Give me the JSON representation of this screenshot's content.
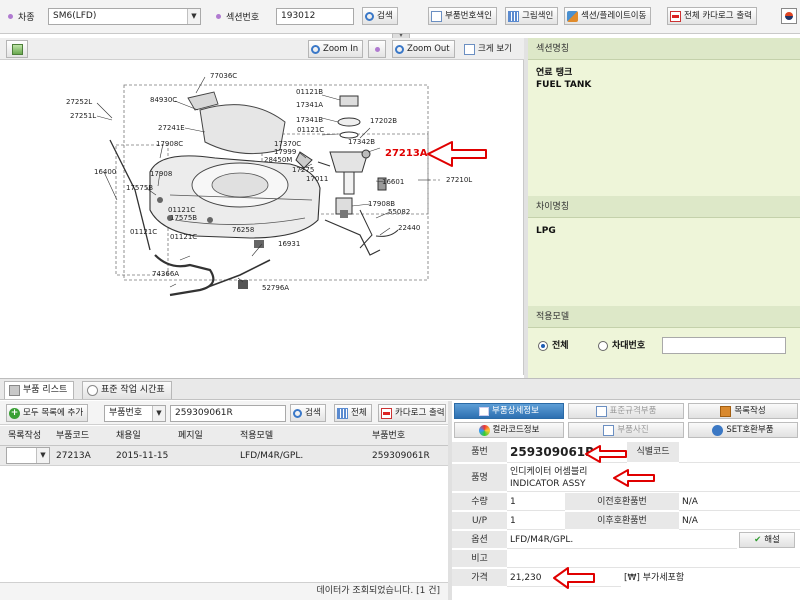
{
  "toolbar": {
    "car_label": "차종",
    "car_value": "SM6(LFD)",
    "section_label": "섹션번호",
    "section_value": "193012",
    "search_btn": "검색",
    "part_index_btn": "부품번호색인",
    "image_index_btn": "그림색인",
    "section_move_btn": "섹션/플레이트이동",
    "print_catalog_btn": "전체 카다로그 출력"
  },
  "diagram_toolbar": {
    "zoom_in": "Zoom In",
    "zoom_out": "Zoom Out",
    "large_view": "크게 보기"
  },
  "diagram": {
    "labels": [
      "77036C",
      "84930C",
      "27252L",
      "27251L",
      "27241E",
      "17908C",
      "16400",
      "17908",
      "17575B",
      "01121C",
      "17575B",
      "01121C",
      "01121C",
      "74366A",
      "76258",
      "16931",
      "52796A",
      "01121B",
      "17341A",
      "17341B",
      "01121C",
      "17202B",
      "17342B",
      "17370C",
      "17999",
      "28450M",
      "17275",
      "17011",
      "16601",
      "27210L",
      "17908B",
      "55082",
      "22440"
    ],
    "highlight_label": "27213A"
  },
  "info": {
    "section_name_header": "섹션명칭",
    "section_name_ko": "연료 탱크",
    "section_name_en": "FUEL TANK",
    "variant_header": "차이명칭",
    "variant_value": "LPG",
    "model_header": "적용모델",
    "option_all": "전체",
    "option_vin": "차대번호",
    "vin_value": ""
  },
  "tabs": {
    "parts_list": "부품 리스트",
    "labor_time": "표준 작업 시간표"
  },
  "list": {
    "add_all_btn": "모두 목록에 추가",
    "filter_select": "부품번호",
    "filter_value": "259309061R",
    "search_btn": "검색",
    "all_btn": "전체",
    "catalog_btn": "카다로그 출력",
    "columns": [
      "목록작성",
      "부품코드",
      "채용일",
      "폐지일",
      "적용모델",
      "부품번호"
    ],
    "rows": [
      {
        "check": "",
        "code": "27213A",
        "adopt": "2015-11-15",
        "abolish": "",
        "model": "LFD/M4R/GPL.",
        "part": "259309061R"
      }
    ],
    "status": "데이터가 조회되었습니다. [1 건]"
  },
  "detail": {
    "btn_detail": "부품상세정보",
    "btn_standard": "표준규격부품",
    "btn_catalog": "목록작성",
    "btn_color": "컬라코드정보",
    "btn_photo": "부품사진",
    "btn_set": "SET호환부품",
    "part_no_label": "품번",
    "part_no_value": "259309061R",
    "ident_label": "식별코드",
    "ident_value": "",
    "name_label": "품명",
    "name_ko": "인디케이터 어셈블리",
    "name_en": "INDICATOR ASSY",
    "qty_label": "수량",
    "qty_value": "1",
    "prev_label": "이전호환품번",
    "prev_value": "N/A",
    "up_label": "U/P",
    "up_value": "1",
    "next_label": "이후호환품번",
    "next_value": "N/A",
    "option_label": "옵션",
    "option_value": "LFD/M4R/GPL.",
    "decode_btn": "해설",
    "note_label": "비고",
    "note_value": "",
    "price_label": "가격",
    "price_value": "21,230",
    "price_unit": "[₩] 부가세포함"
  }
}
